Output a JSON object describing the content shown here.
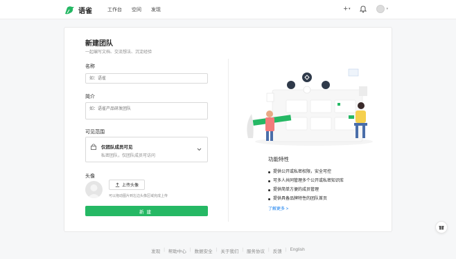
{
  "header": {
    "logo_text": "语雀",
    "nav": [
      "工作台",
      "空间",
      "发现"
    ],
    "add_icon": "plus-icon",
    "add_label": "+",
    "notification_icon": "bell-icon",
    "avatar_icon": "user-avatar-icon",
    "brand_color": "#25b864"
  },
  "form": {
    "title": "新建团队",
    "subtitle": "一起编写文档、交流想法、沉淀经验",
    "name_label": "名称",
    "name_placeholder": "如：语雀",
    "intro_label": "简介",
    "intro_placeholder": "如：语雀产品研发团队",
    "visibility_label": "可见范围",
    "visibility": {
      "icon": "lock-icon",
      "title": "仅团队成员可见",
      "desc": "私密团队，仅团队成员可访问"
    },
    "avatar_label": "头像",
    "upload_label": "上传头像",
    "upload_hint": "可以拖动图片到左边头像区域完成上传",
    "submit_label": "新建"
  },
  "features": {
    "title": "功能特性",
    "items": [
      "提供公开或私密权限，安全可控",
      "可多人共同管理多个公开或私密知识库",
      "提供简单方便的成员管理",
      "提供具备品牌特性的团队首页"
    ],
    "learn_more": "了解更多 >"
  },
  "footer": {
    "links": [
      "发现",
      "帮助中心",
      "数据安全",
      "关于我们",
      "服务协议",
      "反馈",
      "English"
    ]
  },
  "floating": {
    "icon": "gift-icon"
  }
}
